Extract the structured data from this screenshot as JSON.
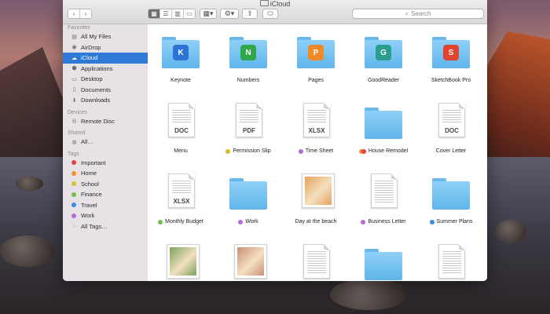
{
  "window": {
    "title": "iCloud"
  },
  "toolbar": {
    "back_glyph": "‹",
    "forward_glyph": "›",
    "search_placeholder": "Search",
    "share_glyph": "⇪"
  },
  "sidebar": {
    "sections": [
      {
        "heading": "Favorites",
        "items": [
          {
            "label": "All My Files",
            "icon": "all-files-icon"
          },
          {
            "label": "AirDrop",
            "icon": "airdrop-icon"
          },
          {
            "label": "iCloud",
            "icon": "cloud-icon",
            "selected": true
          },
          {
            "label": "Applications",
            "icon": "applications-icon"
          },
          {
            "label": "Desktop",
            "icon": "desktop-icon"
          },
          {
            "label": "Documents",
            "icon": "documents-icon"
          },
          {
            "label": "Downloads",
            "icon": "downloads-icon"
          }
        ]
      },
      {
        "heading": "Devices",
        "items": [
          {
            "label": "Remote Disc",
            "icon": "disc-icon"
          }
        ]
      },
      {
        "heading": "Shared",
        "items": [
          {
            "label": "All…",
            "icon": "network-icon"
          }
        ]
      },
      {
        "heading": "Tags",
        "items": [
          {
            "label": "Important",
            "tag_color": "#e0443e"
          },
          {
            "label": "Home",
            "tag_color": "#f5902b"
          },
          {
            "label": "School",
            "tag_color": "#d6c12a"
          },
          {
            "label": "Finance",
            "tag_color": "#6cc04a"
          },
          {
            "label": "Travel",
            "tag_color": "#3a8de0"
          },
          {
            "label": "Work",
            "tag_color": "#b36cd9"
          },
          {
            "label": "All Tags…",
            "icon": "all-tags-icon"
          }
        ]
      }
    ]
  },
  "files": [
    {
      "name": "Keynote",
      "kind": "folder",
      "emblem": "K",
      "emblem_color": "#2d73d6"
    },
    {
      "name": "Numbers",
      "kind": "folder",
      "emblem": "N",
      "emblem_color": "#2ea84a"
    },
    {
      "name": "Pages",
      "kind": "folder",
      "emblem": "P",
      "emblem_color": "#f08a24"
    },
    {
      "name": "GoodReader",
      "kind": "folder",
      "emblem": "G",
      "emblem_color": "#2a9d8f"
    },
    {
      "name": "SketchBook Pro",
      "kind": "folder",
      "emblem": "S",
      "emblem_color": "#e2452f"
    },
    {
      "name": "Menu",
      "kind": "doc",
      "badge": "DOC"
    },
    {
      "name": "Permission Slip",
      "kind": "doc",
      "badge": "PDF",
      "tag_color": "#d6c12a"
    },
    {
      "name": "Time Sheet",
      "kind": "doc",
      "badge": "XLSX",
      "tag_color": "#b36cd9"
    },
    {
      "name": "House Remodel",
      "kind": "folder-plain",
      "tag_color": "#f5902b",
      "tag_color2": "#e0443e"
    },
    {
      "name": "Cover Letter",
      "kind": "doc",
      "badge": "DOC"
    },
    {
      "name": "Monthly Budget",
      "kind": "doc",
      "badge": "XLSX",
      "tag_color": "#6cc04a"
    },
    {
      "name": "Work",
      "kind": "folder-plain",
      "tag_color": "#b36cd9"
    },
    {
      "name": "Day at the beach",
      "kind": "photo",
      "photo_color": "#e6a15a"
    },
    {
      "name": "Business Letter",
      "kind": "doc-plain",
      "tag_color": "#b36cd9"
    },
    {
      "name": "Summer Plans",
      "kind": "folder-plain",
      "tag_color": "#3a8de0"
    },
    {
      "name": "",
      "kind": "photo",
      "photo_color": "#7aa35a"
    },
    {
      "name": "",
      "kind": "photo",
      "photo_color": "#c98f7a"
    },
    {
      "name": "",
      "kind": "doc-plain"
    },
    {
      "name": "",
      "kind": "folder-plain"
    },
    {
      "name": "",
      "kind": "doc-plain"
    }
  ]
}
